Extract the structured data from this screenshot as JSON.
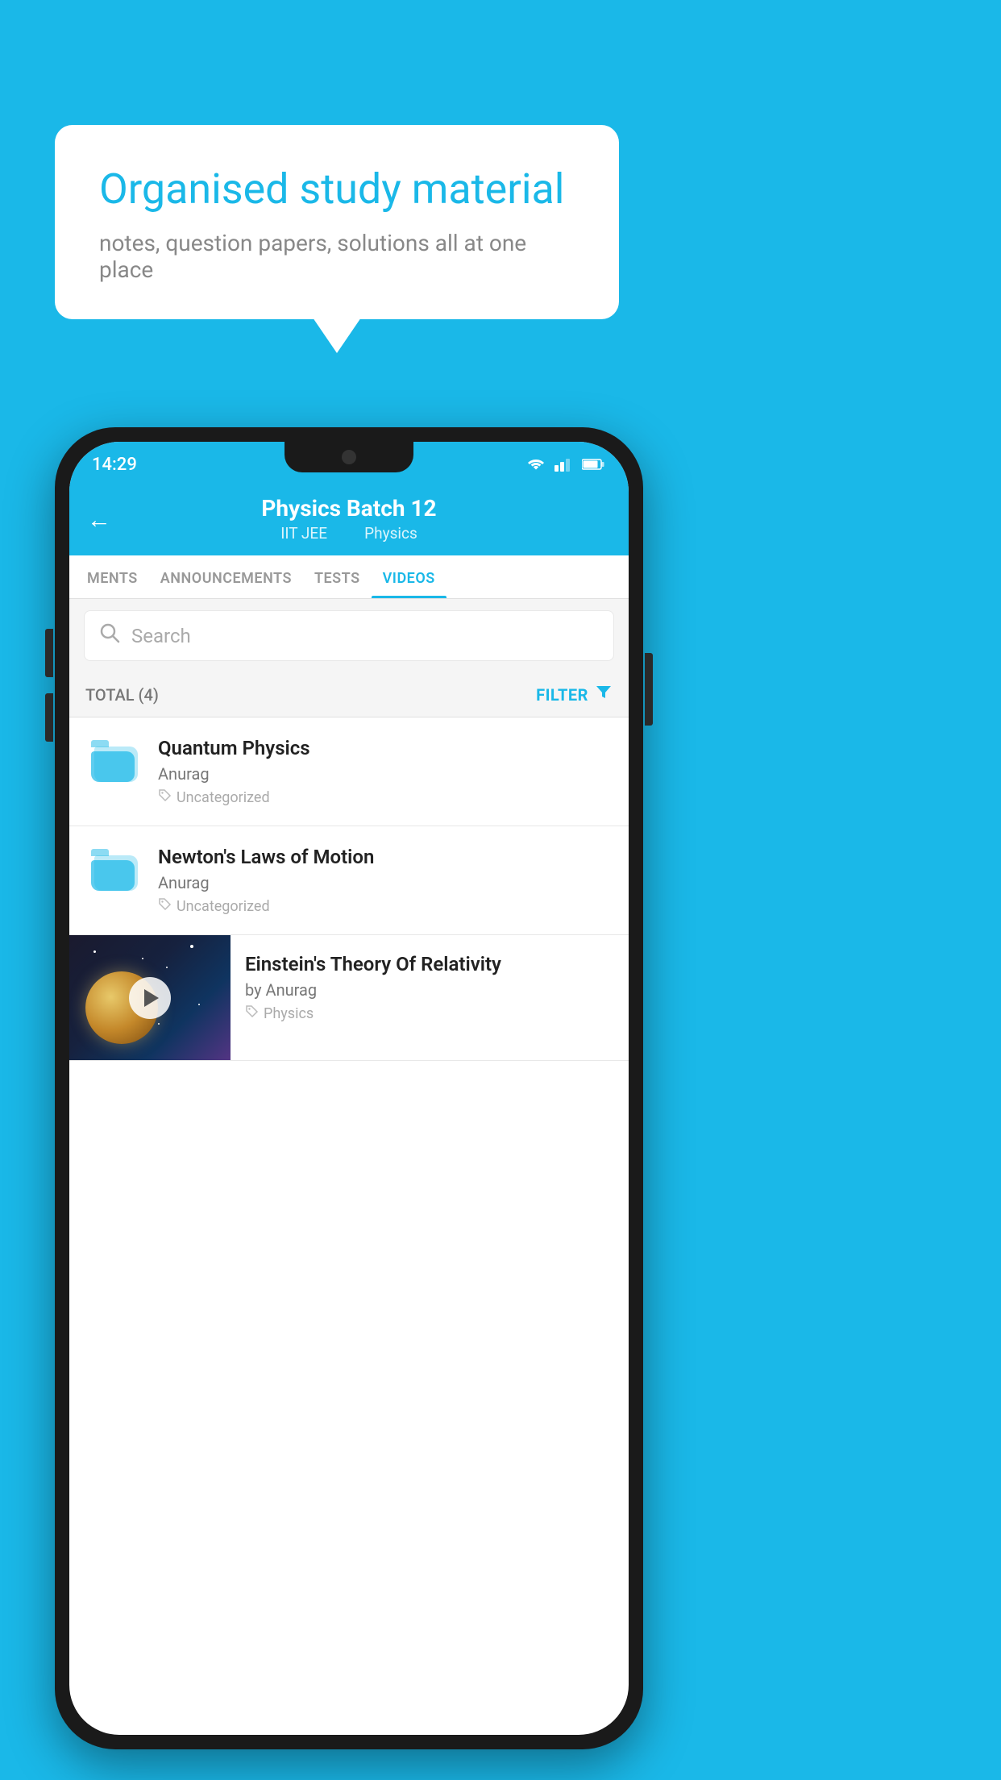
{
  "app": {
    "background_color": "#1ab8e8"
  },
  "speech_bubble": {
    "title": "Organised study material",
    "subtitle": "notes, question papers, solutions all at one place"
  },
  "status_bar": {
    "time": "14:29"
  },
  "header": {
    "title": "Physics Batch 12",
    "subtitle_part1": "IIT JEE",
    "subtitle_part2": "Physics",
    "back_icon": "←"
  },
  "tabs": [
    {
      "label": "MENTS",
      "active": false
    },
    {
      "label": "ANNOUNCEMENTS",
      "active": false
    },
    {
      "label": "TESTS",
      "active": false
    },
    {
      "label": "VIDEOS",
      "active": true
    }
  ],
  "search": {
    "placeholder": "Search"
  },
  "filter_bar": {
    "total_label": "TOTAL (4)",
    "filter_label": "FILTER"
  },
  "videos": [
    {
      "id": 1,
      "title": "Quantum Physics",
      "author": "Anurag",
      "tag": "Uncategorized",
      "type": "folder"
    },
    {
      "id": 2,
      "title": "Newton's Laws of Motion",
      "author": "Anurag",
      "tag": "Uncategorized",
      "type": "folder"
    },
    {
      "id": 3,
      "title": "Einstein's Theory Of Relativity",
      "author": "by Anurag",
      "tag": "Physics",
      "type": "thumbnail"
    }
  ]
}
